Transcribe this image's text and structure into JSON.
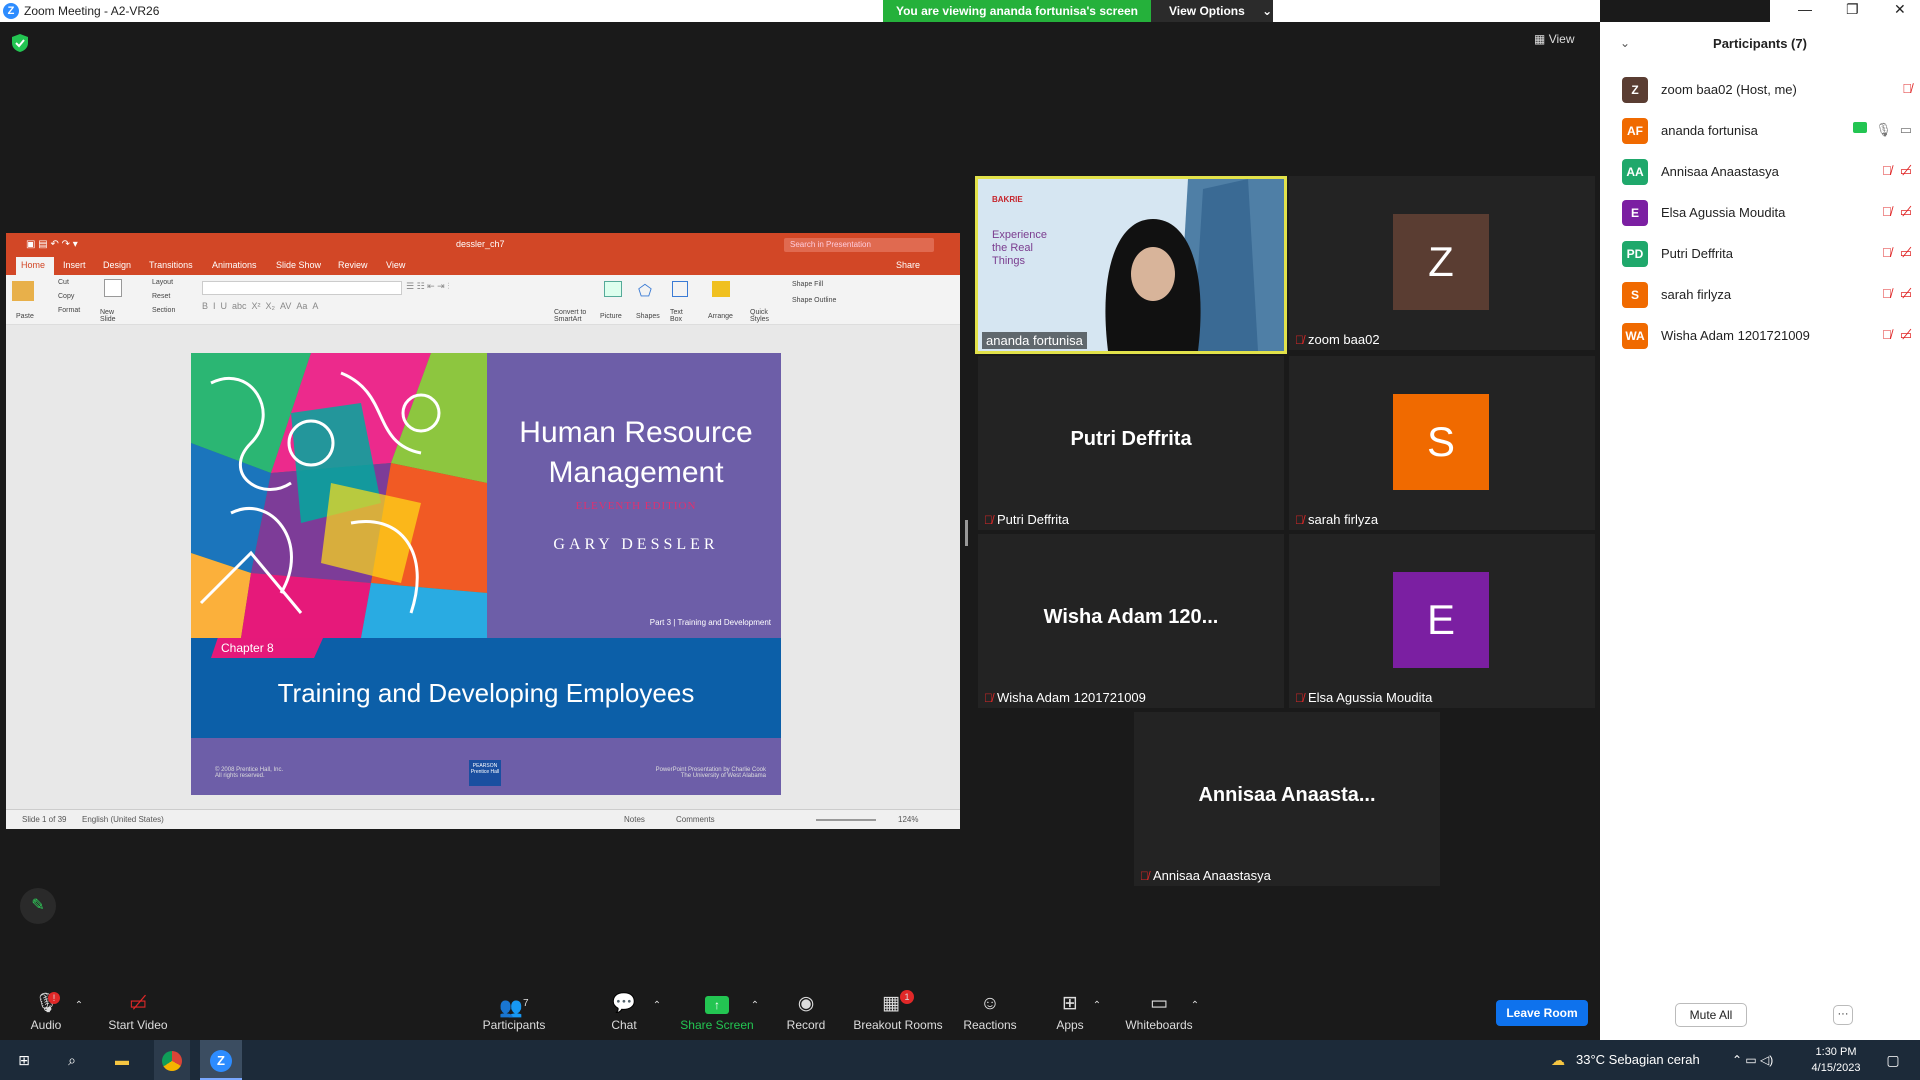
{
  "window": {
    "title": "Zoom Meeting - A2-VR26",
    "app_icon": "zoom-icon"
  },
  "share_banner": {
    "text": "You are viewing ananda fortunisa's screen",
    "view_options": "View Options"
  },
  "view_button": "View",
  "powerpoint": {
    "filename": "dessler_ch7",
    "search_placeholder": "Search in Presentation",
    "share": "Share",
    "tabs": [
      "Home",
      "Insert",
      "Design",
      "Transitions",
      "Animations",
      "Slide Show",
      "Review",
      "View"
    ],
    "ribbon": {
      "paste": "Paste",
      "cut": "Cut",
      "copy": "Copy",
      "format": "Format",
      "new_slide": "New Slide",
      "layout": "Layout",
      "reset": "Reset",
      "section": "Section",
      "convert": "Convert to SmartArt",
      "picture": "Picture",
      "shapes": "Shapes",
      "text_box": "Text Box",
      "arrange": "Arrange",
      "quick_styles": "Quick Styles",
      "shape_fill": "Shape Fill",
      "shape_outline": "Shape Outline"
    },
    "status": {
      "slide": "Slide 1 of 39",
      "language": "English (United States)",
      "notes": "Notes",
      "comments": "Comments",
      "zoom": "124%"
    },
    "slide": {
      "title": "Human Resource Management",
      "edition": "ELEVENTH EDITION",
      "author": "GARY DESSLER",
      "part": "Part 3  |  Training and Development",
      "chapter": "Chapter 8",
      "subtitle": "Training and Developing Employees",
      "copyright": "© 2008 Prentice Hall, Inc.\nAll rights reserved.",
      "publisher": "PEARSON Prentice Hall",
      "credit": "PowerPoint Presentation by Charlie Cook\nThe University of West Alabama"
    }
  },
  "tiles": [
    {
      "label": "ananda fortunisa",
      "type": "video",
      "slide_text": "Experience the Real Things",
      "brand": "BAKRIE"
    },
    {
      "label": "zoom baa02",
      "initial": "Z",
      "color": "#5a3d32",
      "muted": true
    },
    {
      "label": "Putri Deffrita",
      "big": "Putri Deffrita",
      "muted": true
    },
    {
      "label": "sarah firlyza",
      "initial": "S",
      "color": "#f06a00",
      "muted": true
    },
    {
      "label": "Wisha Adam 1201721009",
      "big": "Wisha Adam 120...",
      "muted": true
    },
    {
      "label": "Elsa Agussia Moudita",
      "initial": "E",
      "color": "#7b1fa2",
      "muted": true
    },
    {
      "label": "Annisaa Anaastasya",
      "big": "Annisaa  Anaasta...",
      "muted": true
    }
  ],
  "participants_panel": {
    "title": "Participants (7)",
    "participants": [
      {
        "initials": "Z",
        "name": "zoom baa02 (Host, me)",
        "color": "#5a3d32"
      },
      {
        "initials": "AF",
        "name": "ananda fortunisa",
        "color": "#f06a00"
      },
      {
        "initials": "AA",
        "name": "Annisaa Anaastasya",
        "color": "#1fa86b"
      },
      {
        "initials": "E",
        "name": "Elsa Agussia Moudita",
        "color": "#7b1fa2"
      },
      {
        "initials": "PD",
        "name": "Putri Deffrita",
        "color": "#1fa86b"
      },
      {
        "initials": "S",
        "name": "sarah firlyza",
        "color": "#f06a00"
      },
      {
        "initials": "WA",
        "name": "Wisha Adam 1201721009",
        "color": "#f06a00"
      }
    ],
    "mute_all": "Mute All",
    "more": "···"
  },
  "toolbar": {
    "audio": "Audio",
    "start_video": "Start Video",
    "participants": "Participants",
    "participants_count": "7",
    "chat": "Chat",
    "share_screen": "Share Screen",
    "record": "Record",
    "breakout_rooms": "Breakout Rooms",
    "breakout_badge": "1",
    "reactions": "Reactions",
    "apps": "Apps",
    "whiteboards": "Whiteboards",
    "leave_room": "Leave Room"
  },
  "taskbar": {
    "weather": "33°C  Sebagian cerah",
    "time": "1:30 PM",
    "date": "4/15/2023"
  }
}
